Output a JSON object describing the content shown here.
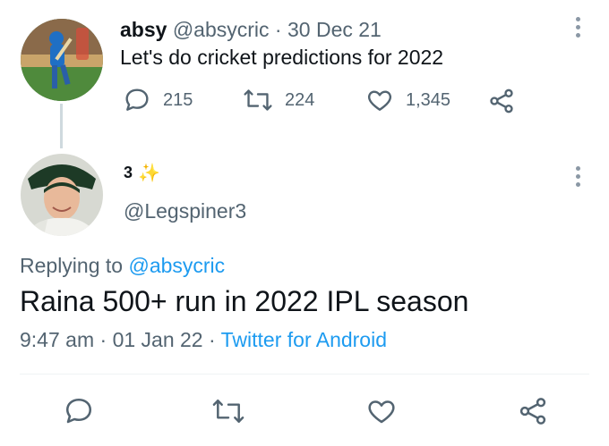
{
  "tweet1": {
    "display_name": "absy",
    "handle": "@absycric",
    "separator": "·",
    "date": "30 Dec 21",
    "text": "Let's do cricket predictions for 2022",
    "actions": {
      "replies": "215",
      "retweets": "224",
      "likes": "1,345"
    }
  },
  "tweet2": {
    "display_name": "3",
    "name_emoji": "✨",
    "handle": "@Legspiner3",
    "replying_prefix": "Replying to",
    "replying_to": "@absycric",
    "text": "Raina 500+ run in 2022 IPL season",
    "time": "9:47 am",
    "separator": "·",
    "date": "01 Jan 22",
    "source": "Twitter for Android"
  },
  "icons": [
    "reply-icon",
    "retweet-icon",
    "like-icon",
    "share-icon",
    "more-icon"
  ],
  "colors": {
    "text": "#0f1419",
    "muted": "#536471",
    "link": "#1d9bf0",
    "divider": "#eff3f4",
    "thread_line": "#cfd9de"
  }
}
